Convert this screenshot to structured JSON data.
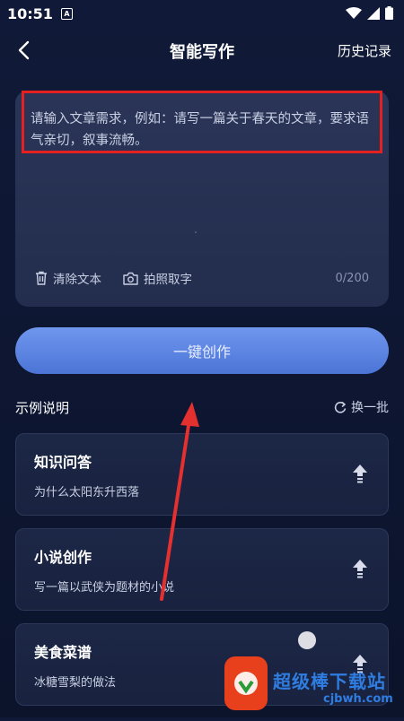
{
  "status_bar": {
    "time": "10:51",
    "notification_letter": "A"
  },
  "header": {
    "title": "智能写作",
    "history": "历史记录"
  },
  "input": {
    "placeholder": "请输入文章需求，例如：请写一篇关于春天的文章，要求语气亲切，叙事流畅。",
    "clear_label": "清除文本",
    "photo_label": "拍照取字",
    "char_count": "0/200"
  },
  "create_button": "一键创作",
  "examples": {
    "title": "示例说明",
    "refresh": "换一批",
    "items": [
      {
        "title": "知识问答",
        "desc": "为什么太阳东升西落"
      },
      {
        "title": "小说创作",
        "desc": "写一篇以武侠为题材的小说"
      },
      {
        "title": "美食菜谱",
        "desc": "冰糖雪梨的做法"
      }
    ]
  },
  "watermark": {
    "text": "超级棒下载站",
    "url": "cjbwh.com"
  },
  "colors": {
    "accent": "#5b82e0",
    "highlight_box": "#e52020",
    "background": "#101a38"
  }
}
